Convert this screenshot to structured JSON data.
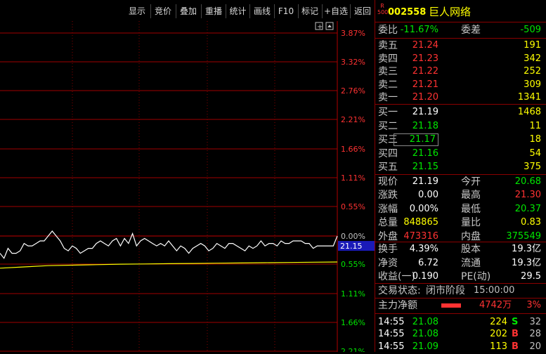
{
  "toolbar": {
    "buttons": [
      "显示",
      "竞价",
      "叠加",
      "重播",
      "统计",
      "画线",
      "F10",
      "标记",
      "+自选",
      "返回"
    ]
  },
  "chart_data": {
    "type": "line",
    "right_axis_labels": [
      "3.87%",
      "3.32%",
      "2.76%",
      "2.21%",
      "1.66%",
      "1.11%",
      "0.55%",
      "0.00%",
      "0.55%",
      "1.11%",
      "1.66%",
      "2.21%"
    ],
    "current_price_label": "21.15",
    "price_series": [
      21.12,
      21.1,
      21.14,
      21.12,
      21.12,
      21.13,
      21.16,
      21.15,
      21.15,
      21.16,
      21.17,
      21.17,
      21.19,
      21.21,
      21.19,
      21.17,
      21.14,
      21.13,
      21.15,
      21.14,
      21.12,
      21.13,
      21.14,
      21.14,
      21.16,
      21.17,
      21.16,
      21.15,
      21.17,
      21.18,
      21.15,
      21.18,
      21.16,
      21.2,
      21.15,
      21.17,
      21.18,
      21.17,
      21.16,
      21.15,
      21.16,
      21.15,
      21.17,
      21.15,
      21.13,
      21.15,
      21.14,
      21.12,
      21.14,
      21.15,
      21.16,
      21.15,
      21.13,
      21.14,
      21.16,
      21.15,
      21.14,
      21.16,
      21.16,
      21.15,
      21.14,
      21.13,
      21.15,
      21.14,
      21.15,
      21.17,
      21.15,
      21.16,
      21.16,
      21.15,
      21.17,
      21.16,
      21.16,
      21.17,
      21.17,
      21.17,
      21.16,
      21.16,
      21.14,
      21.15,
      21.15,
      21.15,
      21.15,
      21.15,
      21.19
    ],
    "avg_series": [
      21.06,
      21.065,
      21.07,
      21.072,
      21.074,
      21.076,
      21.077,
      21.078,
      21.079,
      21.08,
      21.081,
      21.082,
      21.083,
      21.084,
      21.085
    ]
  },
  "panel": {
    "logo_r": "R",
    "logo_num": "500",
    "code": "002558",
    "name": "巨人网络",
    "wb_label": "委比",
    "wb_value": "-11.67%",
    "wc_label": "委差",
    "wc_value": "-509",
    "asks": [
      {
        "label": "卖五",
        "price": "21.24",
        "vol": "191"
      },
      {
        "label": "卖四",
        "price": "21.23",
        "vol": "342"
      },
      {
        "label": "卖三",
        "price": "21.22",
        "vol": "252"
      },
      {
        "label": "卖二",
        "price": "21.21",
        "vol": "309"
      },
      {
        "label": "卖一",
        "price": "21.20",
        "vol": "1341"
      }
    ],
    "bids": [
      {
        "label": "买一",
        "price": "21.19",
        "vol": "1468"
      },
      {
        "label": "买二",
        "price": "21.18",
        "vol": "11"
      },
      {
        "label": "买三",
        "price": "21.17",
        "vol": "18"
      },
      {
        "label": "买四",
        "price": "21.16",
        "vol": "54"
      },
      {
        "label": "买五",
        "price": "21.15",
        "vol": "375"
      }
    ],
    "quote": [
      {
        "l1": "现价",
        "v1": "21.19",
        "l2": "今开",
        "v2": "20.68"
      },
      {
        "l1": "涨跌",
        "v1": "0.00",
        "l2": "最高",
        "v2": "21.30"
      },
      {
        "l1": "涨幅",
        "v1": "0.00%",
        "l2": "最低",
        "v2": "20.37"
      },
      {
        "l1": "总量",
        "v1": "848865",
        "l2": "量比",
        "v2": "0.83"
      },
      {
        "l1": "外盘",
        "v1": "473316",
        "l2": "内盘",
        "v2": "375549"
      }
    ],
    "stats": [
      {
        "l1": "换手",
        "v1": "4.39%",
        "l2": "股本",
        "v2": "19.3亿"
      },
      {
        "l1": "净资",
        "v1": "6.72",
        "l2": "流通",
        "v2": "19.3亿"
      },
      {
        "l1": "收益(一)",
        "v1": "0.190",
        "l2": "PE(动)",
        "v2": "29.5"
      }
    ],
    "trade_status_label": "交易状态:",
    "trade_status": "闭市阶段",
    "trade_time": "15:00:00",
    "main_net_label": "主力净额",
    "main_net_value": "4742万",
    "main_net_pct": "3%",
    "ticks": [
      {
        "time": "14:55",
        "price": "21.08",
        "vol": "224",
        "side": "S",
        "num": "32"
      },
      {
        "time": "14:55",
        "price": "21.08",
        "vol": "202",
        "side": "B",
        "num": "28"
      },
      {
        "time": "14:55",
        "price": "21.09",
        "vol": "113",
        "side": "B",
        "num": "20"
      }
    ]
  }
}
